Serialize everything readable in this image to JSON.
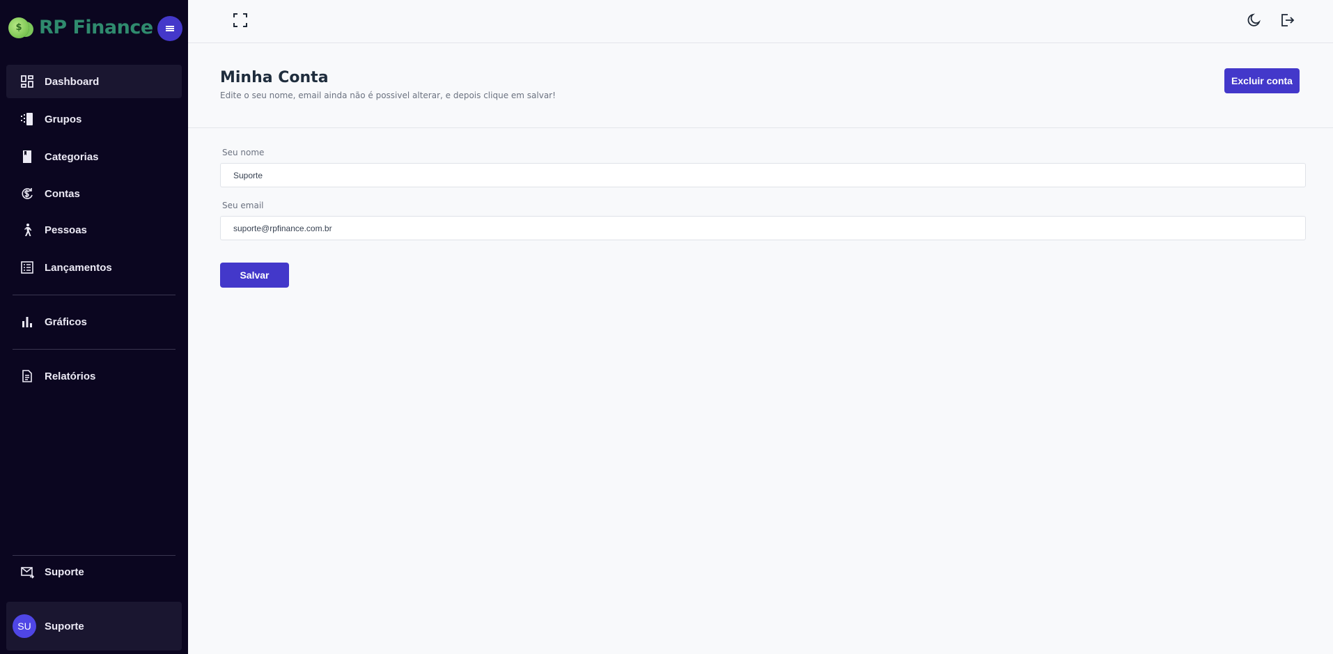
{
  "brand": {
    "name": "RP Finance",
    "coin_symbol": "$",
    "accent": "#4338ca"
  },
  "sidebar": {
    "items": [
      {
        "label": "Dashboard",
        "icon": "dashboard-icon"
      },
      {
        "label": "Grupos",
        "icon": "groups-icon"
      },
      {
        "label": "Categorias",
        "icon": "categories-icon"
      },
      {
        "label": "Contas",
        "icon": "accounts-icon"
      },
      {
        "label": "Pessoas",
        "icon": "person-walking-icon"
      },
      {
        "label": "Lançamentos",
        "icon": "list-icon"
      },
      {
        "label": "Gráficos",
        "icon": "bar-chart-icon"
      },
      {
        "label": "Relatórios",
        "icon": "report-icon"
      }
    ],
    "support": {
      "label": "Suporte",
      "icon": "mail-icon"
    },
    "user": {
      "initials": "SU",
      "name": "Suporte"
    }
  },
  "topbar": {
    "fullscreen_icon": "fullscreen-icon",
    "theme_icon": "moon-icon",
    "logout_icon": "logout-icon"
  },
  "page": {
    "title": "Minha Conta",
    "subtitle": "Edite o seu nome, email ainda não é possivel alterar, e depois clique em salvar!",
    "delete_button": "Excluir conta"
  },
  "form": {
    "name_label": "Seu nome",
    "name_value": "Suporte",
    "email_label": "Seu email",
    "email_value": "suporte@rpfinance.com.br",
    "save_button": "Salvar"
  }
}
